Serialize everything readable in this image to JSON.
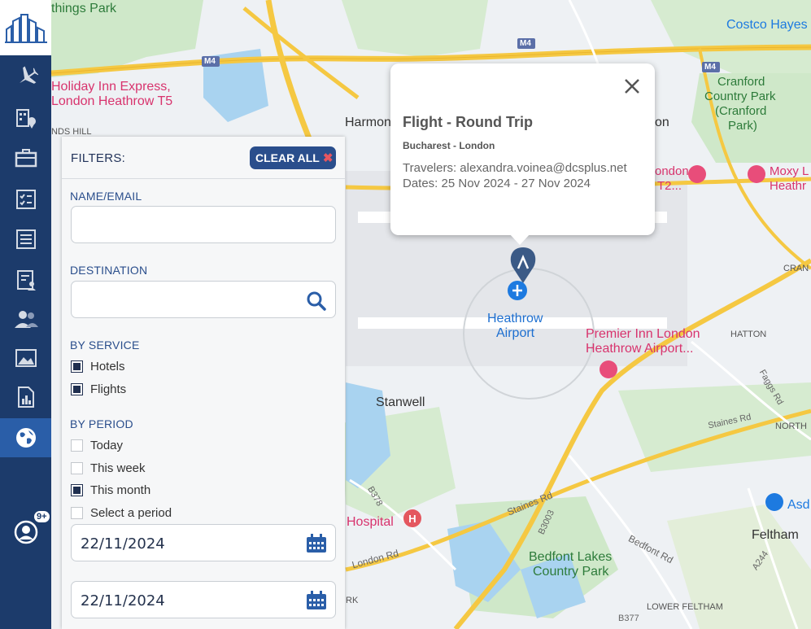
{
  "map": {
    "labels": {
      "things_park": "things Park",
      "holiday_inn_1": "Holiday Inn Express,",
      "holiday_inn_2": "London Heathrow T5",
      "harmondsworth": "Harmon",
      "on": "on",
      "costco": "Costco Hayes",
      "cranford_1": "Cranford",
      "cranford_2": "Country Park",
      "cranford_3": "(Cranford",
      "cranford_4": "Park)",
      "london_t2_1": "ondon",
      "london_t2_2": "T2...",
      "moxy_1": "Moxy L",
      "moxy_2": "Heathr",
      "heathrow_1": "Heathrow",
      "heathrow_2": "Airport",
      "premier_1": "Premier Inn London",
      "premier_2": "Heathrow Airport...",
      "hatton": "HATTON",
      "cran": "CRAN",
      "stanwell": "Stanwell",
      "north": "NORTH",
      "staines_rd_1": "Staines Rd",
      "staines_rd_2": "Staines Rd",
      "faggs_rd": "Faggs Rd",
      "hospital": "Hospital",
      "b378": "B378",
      "b3003": "B3003",
      "bedfont_rd": "Bedfont Rd",
      "bedfont_lakes_1": "Bedfont Lakes",
      "bedfont_lakes_2": "Country Park",
      "london_rd": "London Rd",
      "feltham": "Feltham",
      "asd": "Asd",
      "a244": "A244",
      "lower_feltham": "LOWER FELTHAM",
      "b377": "B377",
      "rk": "RK",
      "nds_hill": "NDS HILL",
      "m4_1": "M4",
      "m4_2": "M4",
      "m4_3": "M4"
    }
  },
  "sidebar": {
    "items": [
      {
        "name": "flights",
        "icon": "airplane-icon"
      },
      {
        "name": "hotels",
        "icon": "hotel-location-icon"
      },
      {
        "name": "business",
        "icon": "briefcase-icon"
      },
      {
        "name": "tasks",
        "icon": "checklist-icon"
      },
      {
        "name": "news",
        "icon": "newspaper-icon"
      },
      {
        "name": "reports",
        "icon": "clipboard-user-icon"
      },
      {
        "name": "users",
        "icon": "users-icon"
      },
      {
        "name": "gallery",
        "icon": "image-icon"
      },
      {
        "name": "statistics",
        "icon": "bar-report-icon"
      },
      {
        "name": "map",
        "icon": "globe-icon"
      }
    ],
    "profile_badge": "9+"
  },
  "filters": {
    "title": "FILTERS:",
    "clear_all": "CLEAR ALL",
    "name_label": "NAME/EMAIL",
    "name_value": "",
    "destination_label": "DESTINATION",
    "destination_value": "",
    "by_service_label": "BY SERVICE",
    "services": [
      {
        "label": "Hotels",
        "checked": true
      },
      {
        "label": "Flights",
        "checked": true
      }
    ],
    "by_period_label": "BY PERIOD",
    "periods": [
      {
        "label": "Today",
        "checked": false
      },
      {
        "label": "This week",
        "checked": false
      },
      {
        "label": "This month",
        "checked": true
      },
      {
        "label": "Select a period",
        "checked": false
      }
    ],
    "date_from": "22/11/2024",
    "date_to": "22/11/2024"
  },
  "popup": {
    "title": "Flight - Round Trip",
    "route": "Bucharest - London",
    "travelers": "Travelers: alexandra.voinea@dcsplus.net",
    "dates": "Dates: 25 Nov 2024 - 27 Nov 2024"
  },
  "colors": {
    "sidebar": "#1c3b6b",
    "accent": "#2a4e8c",
    "active": "#2a5ea8",
    "road_major": "#f5c842",
    "water": "#a9d3f0",
    "green": "#c8e6c0"
  }
}
